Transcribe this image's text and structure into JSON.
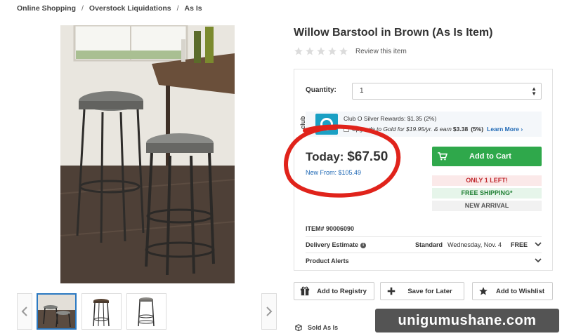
{
  "breadcrumb": {
    "items": [
      "Online Shopping",
      "Overstock Liquidations",
      "As Is"
    ],
    "separator": "/"
  },
  "product": {
    "title": "Willow Barstool in Brown (As Is Item)",
    "rating_stars": 0,
    "review_link": "Review this item"
  },
  "quantity": {
    "label": "Quantity:",
    "value": "1"
  },
  "club_o": {
    "badge_text": "club",
    "line1": "Club O Silver Rewards: $1.35 (2%)",
    "line2_prefix": "Upgrade to Gold for $19.95/yr. & earn",
    "line2_amount": "$3.38",
    "line2_pct": "(5%)",
    "learn_more": "Learn More ›"
  },
  "pricing": {
    "today_label": "Today:",
    "today_price": "$67.50",
    "new_from": "New From: $105.49"
  },
  "cart": {
    "button_label": "Add to Cart"
  },
  "badges": {
    "only_left": "ONLY 1 LEFT!",
    "free_shipping": "FREE SHIPPING*",
    "new_arrival": "NEW ARRIVAL"
  },
  "details": {
    "item_number": "ITEM# 90006090",
    "delivery_label": "Delivery Estimate",
    "delivery_method": "Standard",
    "delivery_date": "Wednesday, Nov. 4",
    "delivery_cost": "FREE",
    "alerts_label": "Product Alerts"
  },
  "actions": {
    "registry": "Add to Registry",
    "save_later": "Save for Later",
    "wishlist": "Add to Wishlist"
  },
  "condition": {
    "label": "Sold As Is"
  },
  "watermark": {
    "text": "unigumushane.com"
  },
  "colors": {
    "cart_green": "#2fa84b",
    "link_blue": "#1d67b4",
    "annotation_red": "#e0231b"
  },
  "icons": [
    "gift-icon",
    "plus-icon",
    "star-icon",
    "cart-icon",
    "chevron-down-icon",
    "chevron-left-icon",
    "chevron-right-icon",
    "box-icon",
    "info-icon"
  ]
}
